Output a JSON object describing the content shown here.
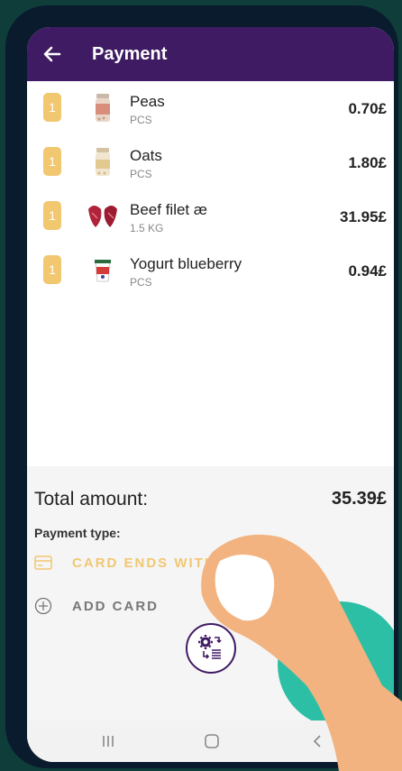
{
  "appbar": {
    "title": "Payment"
  },
  "items": [
    {
      "qty": "1",
      "name": "Peas",
      "unit": "PCS",
      "price": "0.70£",
      "thumb_icon": "peas-jar-icon"
    },
    {
      "qty": "1",
      "name": "Oats",
      "unit": "PCS",
      "price": "1.80£",
      "thumb_icon": "oats-jar-icon"
    },
    {
      "qty": "1",
      "name": "Beef filet æ",
      "unit": "1.5 KG",
      "price": "31.95£",
      "thumb_icon": "beef-icon"
    },
    {
      "qty": "1",
      "name": "Yogurt blueberry",
      "unit": "PCS",
      "price": "0.94£",
      "thumb_icon": "yogurt-icon"
    }
  ],
  "summary": {
    "total_label": "Total amount:",
    "total_value": "35.39£",
    "payment_type_label": "Payment type:",
    "card_label": "CARD ENDS WITH",
    "add_card_label": "ADD CARD"
  },
  "colors": {
    "appbar": "#3f1b63",
    "qty_badge": "#f1c770",
    "accent_teal": "#2cbfa5",
    "background": "#0f3e3a"
  }
}
